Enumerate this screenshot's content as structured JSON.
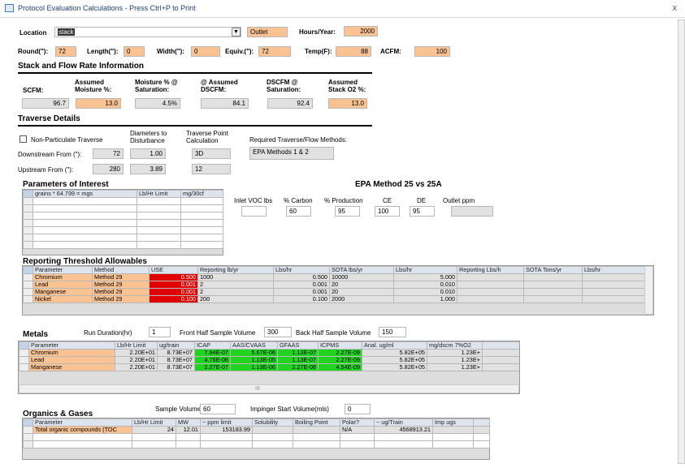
{
  "window": {
    "title": "Protocol Evaluation Calculations - Press Ctrl+P to Print",
    "close": "x"
  },
  "location": {
    "label": "Location",
    "value": "stack",
    "outlet": "Outlet",
    "hours_label": "Hours/Year:",
    "hours": "2000"
  },
  "dims": {
    "round_label": "Round(\"):",
    "round": "72",
    "length_label": "Length(\"):",
    "length": "0",
    "width_label": "Width(\"):",
    "width": "0",
    "equiv_label": "Equiv.(\"):",
    "equiv": "72",
    "temp_label": "Temp(F):",
    "temp": "88",
    "acfm_label": "ACFM:",
    "acfm": "100"
  },
  "stack": {
    "title": "Stack and Flow Rate Information",
    "scfm_label": "SCFM:",
    "scfm": "96.7",
    "moist_label": "Assumed Moisture %:",
    "moist": "13.0",
    "moist_sat_label": "Moisture % @ Saturation:",
    "moist_sat": "4.5%",
    "dscfm_label": "@ Assumed DSCFM:",
    "dscfm": "84.1",
    "dscfm_sat_label": "DSCFM @ Saturation:",
    "dscfm_sat": "92.4",
    "o2_label": "Assumed Stack O2 %:",
    "o2": "13.0"
  },
  "traverse": {
    "title": "Traverse Details",
    "np_label": "Non-Particulate Traverse",
    "diam_label": "Diameters to Disturbance",
    "tpc_label": "Traverse Point Calculation",
    "req_label": "Required Traverse/Flow Methods:",
    "req": "EPA Methods 1 & 2",
    "down_label": "Downstream From (\"):",
    "down": "72",
    "down_d": "1.00",
    "down_t": "3D",
    "up_label": "Upstream From (\"):",
    "up": "280",
    "up_d": "3.89",
    "up_t": "12"
  },
  "poi": {
    "title": "Parameters of Interest",
    "headers": [
      "grains * 64.799 = mgs",
      "Lb/Hr Limit",
      "mg/30cf"
    ]
  },
  "epa": {
    "title": "EPA Method 25 vs 25A",
    "inlet_label": "Inlet VOC lbs",
    "carbon_label": "% Carbon",
    "carbon": "60",
    "prod_label": "% Production",
    "prod": "95",
    "ce_label": "CE",
    "ce": "100",
    "de_label": "DE",
    "de": "95",
    "outlet_label": "Outlet ppm"
  },
  "rta": {
    "title": "Reporting Threshold Allowables",
    "headers": [
      "Parameter",
      "Method",
      "USE",
      "Reporting lb/yr",
      "Lbs/hr",
      "SOTA lbs/yr",
      "Lbs/hr",
      "Reporting Lbs/h",
      "SOTA Tons/yr",
      "Lbs/hr"
    ],
    "rows": [
      {
        "p": "Chromium",
        "m": "Method 29",
        "use": "0.500",
        "rep": "1000",
        "lbs": "0.500",
        "sota": "10000",
        "lbs2": "5.000"
      },
      {
        "p": "Lead",
        "m": "Method 29",
        "use": "0.001",
        "rep": "2",
        "lbs": "0.001",
        "sota": "20",
        "lbs2": "0.010"
      },
      {
        "p": "Manganese",
        "m": "Method 29",
        "use": "0.001",
        "rep": "2",
        "lbs": "0.001",
        "sota": "20",
        "lbs2": "0.010"
      },
      {
        "p": "Nickel",
        "m": "Method 29",
        "use": "0.100",
        "rep": "200",
        "lbs": "0.100",
        "sota": "2000",
        "lbs2": "1.000"
      }
    ]
  },
  "metals": {
    "title": "Metals",
    "run_label": "Run Duration(hr)",
    "run": "1",
    "front_label": "Front Half Sample Volume",
    "front": "300",
    "back_label": "Back Half Sample Volume",
    "back": "150",
    "headers": [
      "Parameter",
      "Lb/Hr Limit",
      "ug/train",
      "ICAP",
      "AAS/CVAAS",
      "GFAAS",
      "ICPMS",
      "Anal. ug/ml",
      "mg/dscm 7%O2"
    ],
    "rows": [
      {
        "p": "Chromium",
        "lim": "2.20E+01",
        "ug": "8.73E+07",
        "icap": "7.94E-07",
        "aas": "5.67E-06",
        "gf": "1.13E-07",
        "icpms": "2.27E-09",
        "anal": "5.82E+05",
        "mg": "1.23E+"
      },
      {
        "p": "Lead",
        "lim": "2.20E+01",
        "ug": "8.73E+07",
        "icap": "4.76E-06",
        "aas": "1.13E-05",
        "gf": "1.13E-07",
        "icpms": "2.27E-09",
        "anal": "5.82E+05",
        "mg": "1.23E+"
      },
      {
        "p": "Manganese",
        "lim": "2.20E+01",
        "ug": "8.73E+07",
        "icap": "2.27E-07",
        "aas": "1.13E-06",
        "gf": "2.27E-08",
        "icpms": "4.54E-09",
        "anal": "5.82E+05",
        "mg": "1.23E+"
      }
    ],
    "hscroll": "III"
  },
  "org": {
    "title": "Organics & Gases",
    "sv_label": "Sample Volume(L)",
    "sv": "60",
    "imp_label": "Impinger Start Volume(mls)",
    "imp": "0",
    "headers": [
      "Parameter",
      "Lb/Hr Limit",
      "MW",
      "~ ppm limit",
      "Solubility",
      "Boiling Point",
      "Polar?",
      "~ ug/Train",
      "Imp ugs"
    ],
    "row": {
      "p": "Total organic compounds (TOC",
      "lim": "24",
      "mw": "12.01",
      "ppm": "153183.99",
      "polar": "N/A",
      "ug": "4568913.21"
    }
  }
}
